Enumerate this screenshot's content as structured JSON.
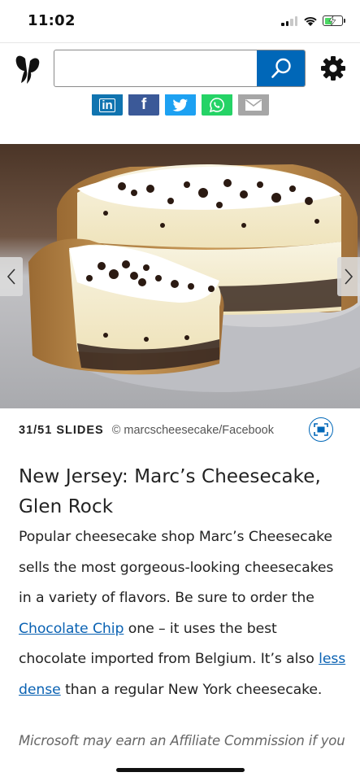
{
  "status_bar": {
    "time": "11:02",
    "battery_level": 0.5,
    "battery_charging": true,
    "signal_bars": 2
  },
  "header": {
    "logo_icon": "msn-butterfly-icon",
    "search": {
      "value": "",
      "placeholder": ""
    },
    "search_icon": "search-icon",
    "settings_icon": "gear-icon"
  },
  "share": {
    "buttons": [
      {
        "name": "linkedin",
        "label": "in",
        "color": "#1074b0"
      },
      {
        "name": "facebook",
        "label": "f",
        "color": "#3b5998"
      },
      {
        "name": "twitter",
        "label": "",
        "color": "#1da1f2"
      },
      {
        "name": "whatsapp",
        "label": "",
        "color": "#25d366"
      },
      {
        "name": "email",
        "label": "",
        "color": "#a6a6a6"
      }
    ]
  },
  "slide": {
    "count": "31/51 SLIDES",
    "credit": "© marcscheesecake/Facebook",
    "title": "New Jersey: Marc’s Cheesecake, Glen Rock",
    "body": {
      "part1": "Popular cheesecake shop Marc’s Cheesecake sells the most gorgeous-looking cheesecakes in a variety of flavors. Be sure to order the ",
      "link1": "Chocolate Chip",
      "part2": " one – it uses the best chocolate imported from Belgium. It’s also ",
      "link2": "less dense",
      "part3": " than a regular New York cheesecake."
    },
    "disclaimer": "Microsoft may earn an Affiliate Commission if you"
  },
  "colors": {
    "accent": "#0067b8",
    "link": "#0a62b3",
    "text": "#222222"
  }
}
